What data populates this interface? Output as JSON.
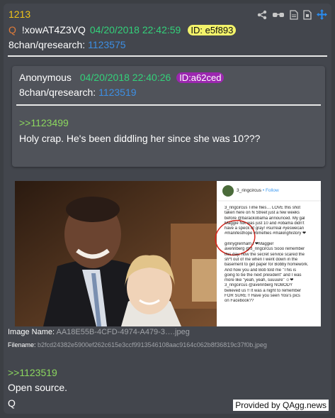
{
  "post": {
    "number": "1213",
    "q_marker": "Q",
    "tripcode": "!xowAT4Z3VQ",
    "timestamp": "04/20/2018 22:42:59",
    "id_label": "ID: e5f893",
    "board": "8chan/qresearch:",
    "post_id": "1123575"
  },
  "toolbar": {
    "icons": [
      "share-icon",
      "glasses-icon",
      "document-icon",
      "archive-icon",
      "move-icon"
    ]
  },
  "quoted": {
    "name": "Anonymous",
    "timestamp": "04/20/2018 22:40:26",
    "id_label": "ID:a62ced",
    "board": "8chan/qresearch:",
    "post_id": "1123519",
    "reply_ref": ">>1123499",
    "text": "Holy crap. He's been diddling her since she was 10???"
  },
  "image": {
    "name_label": "Image Name:",
    "name_value": "AA18E55B-4CFD-4974-A479-3….jpeg",
    "filename_label": "Filename:",
    "filename_value": "b2fcd24382e5900ef262c615e3ccf9913546108aac9164c062b8f36819c37f0b.jpeg",
    "ig_user": "3_ringcircus",
    "ig_follow": "• Follow",
    "ig_caption_lines": [
      "3_ringcircus Time flies… LOVE this shot",
      "taken here on N Street just a few weeks",
      "before @barackobama announced. My gal",
      "Maggie Nix was just 10 and #obama didn't",
      "have a speck of gray! #surreal #yeswecan",
      "#manifesthope #timeflies #makinghistory ❤",
      "",
      "ginnygrenham I ❤Maggie!",
      "avennberg @3_ringcircus Sooo remember",
      "this day, how the secret service scared the",
      "sh*t out of me when I went down in the",
      "basement to get paper for Bobby homework.",
      "And how you and Bob told me \"This is",
      "going to be the next president\" and I was",
      "more like \"yeah, yeah, suuuure\" ☺❤",
      "3_ringcircus @avennberg NOBODY",
      "believed us !! It was a night to remember",
      "FOR SURE !! Have you seen Yosi's pics",
      "on Facebook??"
    ]
  },
  "body": {
    "reply_ref": ">>1123519",
    "line1": "Open source.",
    "line2": "Q"
  },
  "credit": "Provided by QAgg.news",
  "colors": {
    "background": "#3c3f44",
    "card": "#43464d",
    "post_number": "#f0c419",
    "date": "#33d17a",
    "link": "#3d8fe4",
    "greentext": "#8cd75f",
    "id_yellow": "#f3f36a",
    "id_purple": "#9c27b0"
  }
}
